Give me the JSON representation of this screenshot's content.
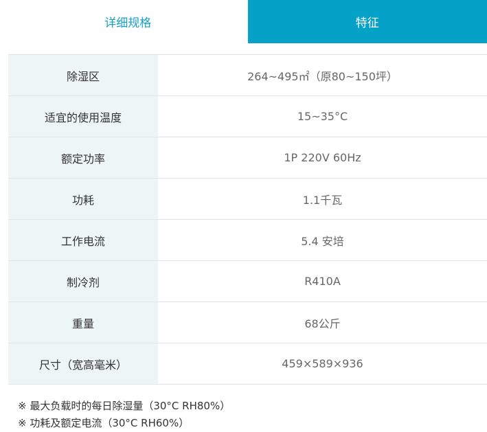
{
  "tabs": [
    {
      "label": "详细规格"
    },
    {
      "label": "特征"
    }
  ],
  "spec_rows": [
    {
      "label": "除湿区",
      "value": "264~495㎡（原80~150坪）"
    },
    {
      "label": "适宜的使用温度",
      "value": "15~35°C"
    },
    {
      "label": "额定功率",
      "value": "1P 220V 60Hz"
    },
    {
      "label": "功耗",
      "value": "1.1千瓦"
    },
    {
      "label": "工作电流",
      "value": "5.4 安培"
    },
    {
      "label": "制冷剂",
      "value": "R410A"
    },
    {
      "label": "重量",
      "value": "68公斤"
    },
    {
      "label": "尺寸（宽高毫米）",
      "value": "459×589×936"
    }
  ],
  "notes": [
    "※ 最大负载时的每日除湿量（30°C RH80%）",
    "※ 功耗及额定电流（30°C RH60%）"
  ],
  "colors": {
    "accent": "#06a1c7",
    "label_bg": "#eef5f7"
  }
}
